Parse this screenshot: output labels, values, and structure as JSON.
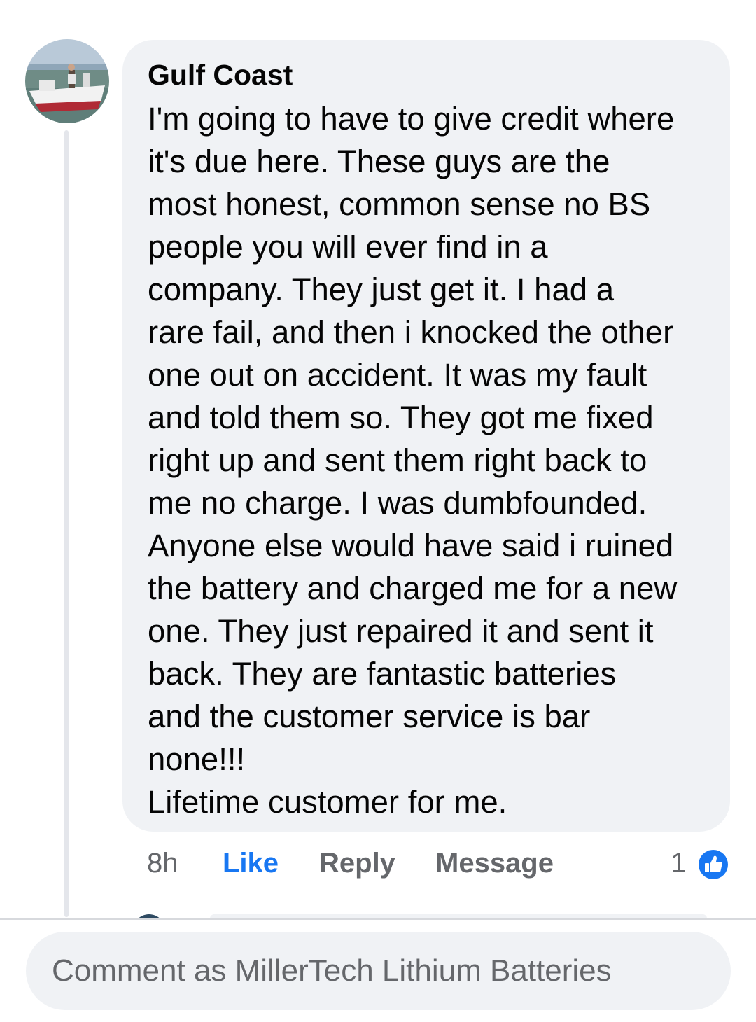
{
  "comment": {
    "author": "Gulf Coast",
    "text": "I'm going to have to give credit where\nit's due here.  These guys are the\nmost honest,  common sense no BS\npeople you will ever find in a\ncompany.  They just get it.  I had a\nrare fail,  and then i knocked the other\none out on accident. It was my fault\nand told them so.  They got me fixed\nright up and sent them right back to\nme no charge.  I was dumbfounded.\nAnyone else would have said i ruined\nthe battery and charged me for a new\none.  They just repaired it and sent it\nback.  They are fantastic batteries\nand the customer service is bar\nnone!!!\nLifetime customer for me.",
    "avatar_icon": "profile-photo-boat"
  },
  "actions": {
    "timestamp": "8h",
    "like_label": "Like",
    "reply_label": "Reply",
    "message_label": "Message",
    "reaction_count": "1",
    "reaction_icon": "thumbs-up-icon"
  },
  "composer": {
    "placeholder": "Comment as MillerTech Lithium Batteries"
  },
  "colors": {
    "like_blue": "#1877f2",
    "bubble_bg": "#f0f2f5",
    "secondary_text": "#65676b"
  }
}
